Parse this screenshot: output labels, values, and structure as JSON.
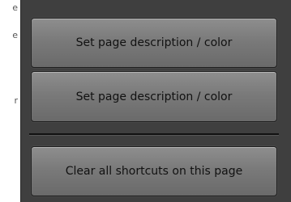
{
  "buttons": {
    "page_description_1": "Set page description / color",
    "page_description_2": "Set page description / color",
    "clear_shortcuts": "Clear all shortcuts on this page"
  },
  "edge_glyphs": {
    "top_1": "e",
    "top_2": "e",
    "middle": "r"
  }
}
